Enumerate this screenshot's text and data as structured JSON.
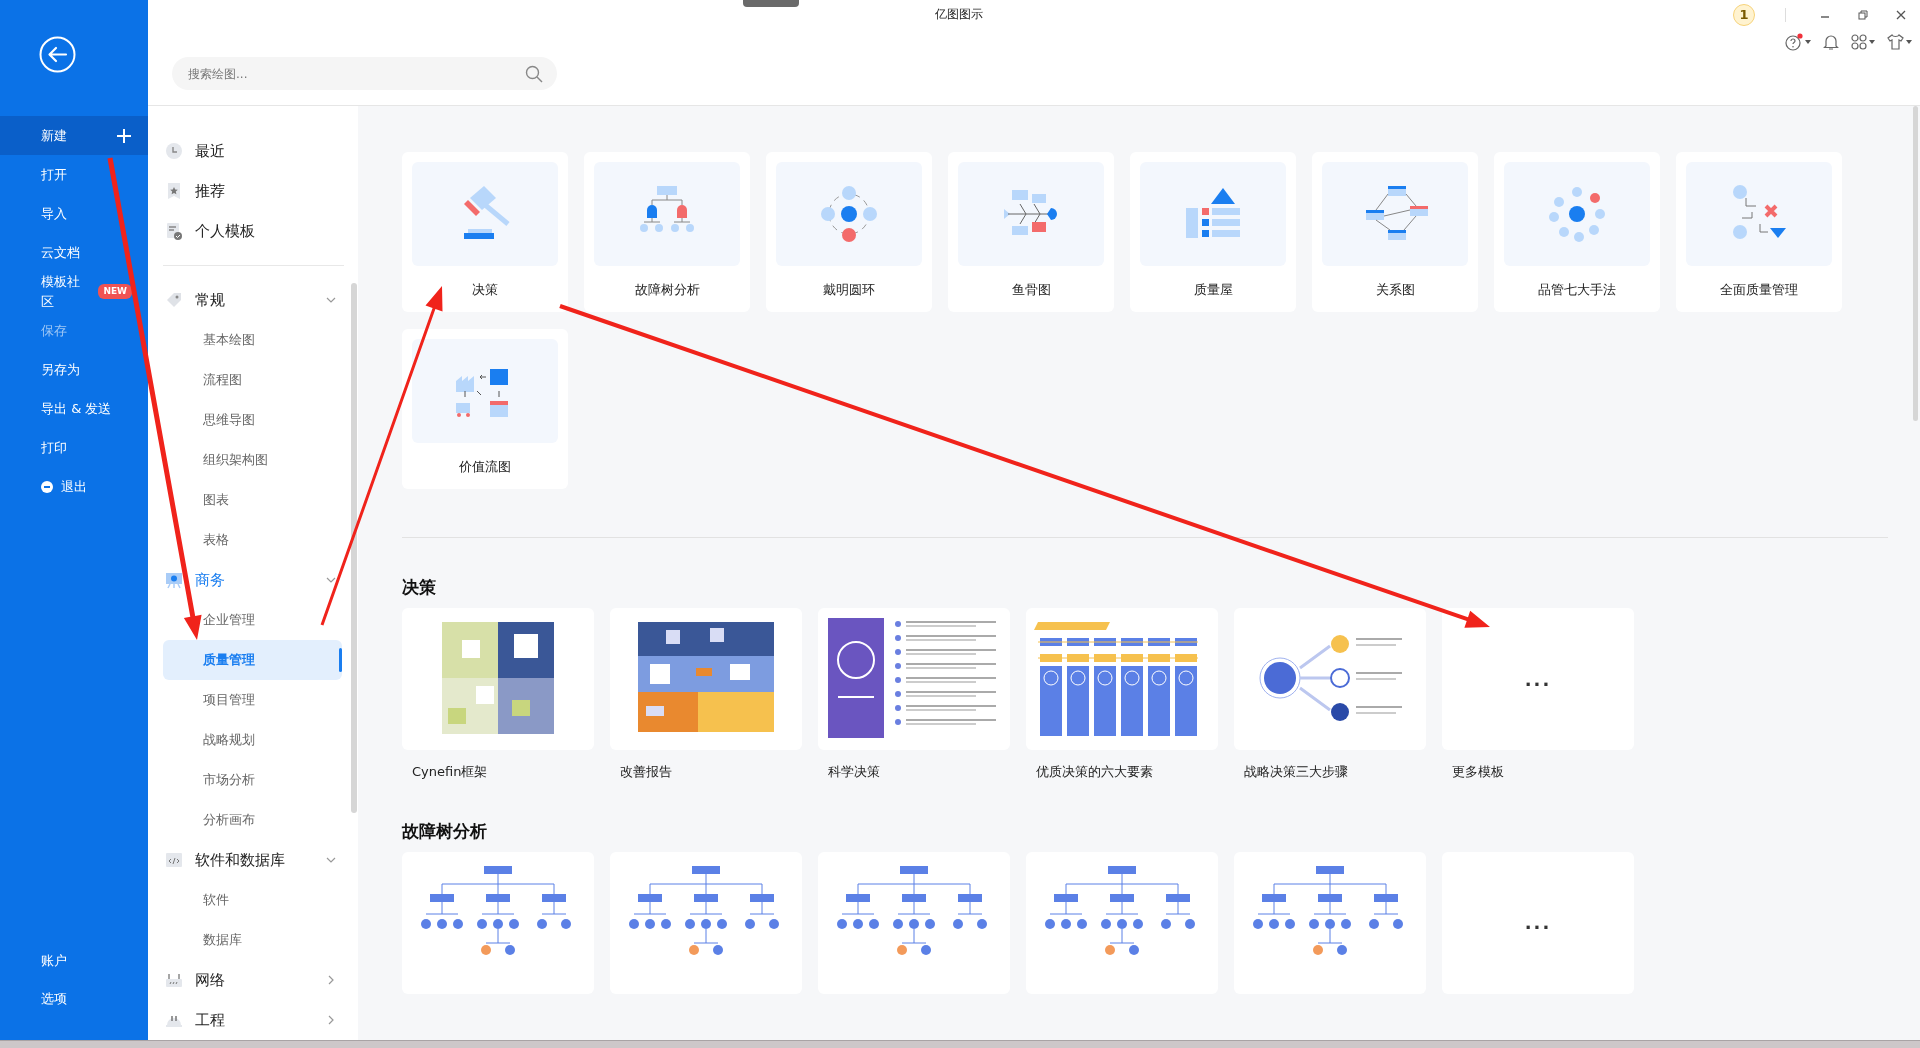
{
  "window": {
    "title": "亿图图示",
    "badge": "1"
  },
  "search": {
    "placeholder": "搜索绘图..."
  },
  "file_menu": [
    {
      "label": "新建",
      "selected": true,
      "disabled": false,
      "kind": "new"
    },
    {
      "label": "打开",
      "selected": false,
      "disabled": false,
      "kind": "plain"
    },
    {
      "label": "导入",
      "selected": false,
      "disabled": false,
      "kind": "plain"
    },
    {
      "label": "云文档",
      "selected": false,
      "disabled": false,
      "kind": "plain"
    },
    {
      "label": "模板社区",
      "selected": false,
      "disabled": false,
      "kind": "badge",
      "badge": "NEW"
    },
    {
      "label": "保存",
      "selected": false,
      "disabled": true,
      "kind": "plain"
    },
    {
      "label": "另存为",
      "selected": false,
      "disabled": false,
      "kind": "plain"
    },
    {
      "label": "导出 & 发送",
      "selected": false,
      "disabled": false,
      "kind": "plain"
    },
    {
      "label": "打印",
      "selected": false,
      "disabled": false,
      "kind": "plain"
    },
    {
      "label": "退出",
      "selected": false,
      "disabled": false,
      "kind": "exit"
    }
  ],
  "file_menu_bottom": [
    "账户",
    "选项"
  ],
  "quick_links": [
    {
      "label": "最近",
      "kind": "clock"
    },
    {
      "label": "推荐",
      "kind": "star"
    },
    {
      "label": "个人模板",
      "kind": "doc"
    }
  ],
  "categories": [
    {
      "label": "常规",
      "kind": "tag",
      "selected": false,
      "expanded": true,
      "children": [
        {
          "label": "基本绘图",
          "selected": false
        },
        {
          "label": "流程图",
          "selected": false
        },
        {
          "label": "思维导图",
          "selected": false
        },
        {
          "label": "组织架构图",
          "selected": false
        },
        {
          "label": "图表",
          "selected": false
        },
        {
          "label": "表格",
          "selected": false
        }
      ]
    },
    {
      "label": "商务",
      "kind": "board",
      "selected": true,
      "expanded": true,
      "children": [
        {
          "label": "企业管理",
          "selected": false
        },
        {
          "label": "质量管理",
          "selected": true
        },
        {
          "label": "项目管理",
          "selected": false
        },
        {
          "label": "战略规划",
          "selected": false
        },
        {
          "label": "市场分析",
          "selected": false
        },
        {
          "label": "分析画布",
          "selected": false
        }
      ]
    },
    {
      "label": "软件和数据库",
      "kind": "code",
      "selected": false,
      "expanded": true,
      "children": [
        {
          "label": "软件",
          "selected": false
        },
        {
          "label": "数据库",
          "selected": false
        }
      ]
    },
    {
      "label": "网络",
      "kind": "router",
      "selected": false,
      "expanded": false
    },
    {
      "label": "工程",
      "kind": "helmet",
      "selected": false,
      "expanded": false
    }
  ],
  "diagram_types": [
    {
      "label": "决策",
      "kind": "gavel"
    },
    {
      "label": "故障树分析",
      "kind": "tree"
    },
    {
      "label": "戴明圆环",
      "kind": "cycle"
    },
    {
      "label": "鱼骨图",
      "kind": "fishbone"
    },
    {
      "label": "质量屋",
      "kind": "house"
    },
    {
      "label": "关系图",
      "kind": "relation"
    },
    {
      "label": "品管七大手法",
      "kind": "seven"
    },
    {
      "label": "全面质量管理",
      "kind": "tqm"
    },
    {
      "label": "价值流图",
      "kind": "flow"
    }
  ],
  "sections": [
    {
      "heading": "决策",
      "templates": [
        {
          "label": "Cynefin框架",
          "kind": "quadrant"
        },
        {
          "label": "改善报告",
          "kind": "report"
        },
        {
          "label": "科学决策",
          "kind": "infographic"
        },
        {
          "label": "优质决策的六大要素",
          "kind": "columns"
        },
        {
          "label": "战略决策三大步骤",
          "kind": "steps"
        },
        {
          "label": "更多模板",
          "kind": "more",
          "more": "..."
        }
      ]
    },
    {
      "heading": "故障树分析",
      "templates": [
        {
          "kind": "tree"
        },
        {
          "kind": "tree"
        },
        {
          "kind": "tree"
        },
        {
          "kind": "tree"
        },
        {
          "kind": "tree"
        },
        {
          "kind": "more",
          "more": "..."
        }
      ]
    }
  ]
}
